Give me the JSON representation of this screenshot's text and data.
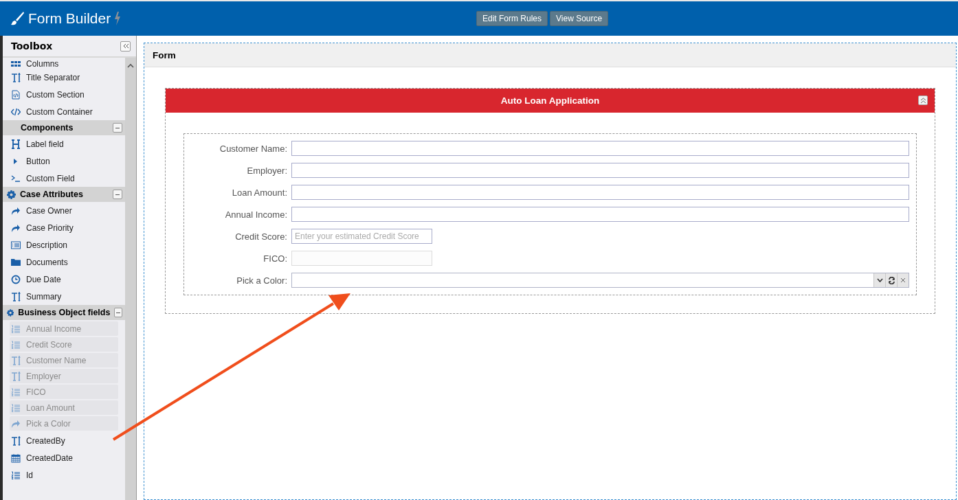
{
  "app": {
    "title": "Form Builder"
  },
  "header_buttons": [
    "Edit Form Rules",
    "View Source"
  ],
  "toolbox": {
    "title": "Toolbox",
    "top_items": [
      {
        "label": "Columns",
        "kind": "grid"
      },
      {
        "label": "Title Separator",
        "kind": "text"
      },
      {
        "label": "Custom Section",
        "kind": "codefile"
      },
      {
        "label": "Custom Container",
        "kind": "code"
      }
    ],
    "groups": [
      {
        "title": "Components",
        "kind": "plain",
        "items": [
          {
            "label": "Label field",
            "kind": "heading"
          },
          {
            "label": "Button",
            "kind": "caret"
          },
          {
            "label": "Custom Field",
            "kind": "terminal"
          }
        ]
      },
      {
        "title": "Case Attributes",
        "kind": "gear",
        "items": [
          {
            "label": "Case Owner",
            "kind": "share"
          },
          {
            "label": "Case Priority",
            "kind": "share"
          },
          {
            "label": "Description",
            "kind": "listbox"
          },
          {
            "label": "Documents",
            "kind": "folder"
          },
          {
            "label": "Due Date",
            "kind": "clock"
          },
          {
            "label": "Summary",
            "kind": "text"
          }
        ]
      },
      {
        "title": "Business Object fields",
        "kind": "gear",
        "items": [
          {
            "label": "Annual Income",
            "kind": "numlist",
            "used": true
          },
          {
            "label": "Credit Score",
            "kind": "numlist",
            "used": true
          },
          {
            "label": "Customer Name",
            "kind": "text",
            "used": true
          },
          {
            "label": "Employer",
            "kind": "text",
            "used": true
          },
          {
            "label": "FICO",
            "kind": "numlist",
            "used": true
          },
          {
            "label": "Loan Amount",
            "kind": "numlist",
            "used": true
          },
          {
            "label": "Pick a Color",
            "kind": "share",
            "used": true
          },
          {
            "label": "CreatedBy",
            "kind": "text",
            "used": false
          },
          {
            "label": "CreatedDate",
            "kind": "calendar",
            "used": false
          },
          {
            "label": "Id",
            "kind": "numlist",
            "used": false
          }
        ]
      }
    ]
  },
  "form": {
    "title": "Form",
    "section": {
      "title": "Auto Loan Application",
      "fields": [
        {
          "label": "Customer Name:",
          "kind": "text",
          "disabled": false
        },
        {
          "label": "Employer:",
          "kind": "text",
          "disabled": false
        },
        {
          "label": "Loan Amount:",
          "kind": "text",
          "disabled": false
        },
        {
          "label": "Annual Income:",
          "kind": "text",
          "disabled": false
        },
        {
          "label": "Credit Score:",
          "kind": "short",
          "placeholder": "Enter your estimated Credit Score",
          "disabled": false
        },
        {
          "label": "FICO:",
          "kind": "short",
          "disabled": true
        },
        {
          "label": "Pick a Color:",
          "kind": "combo",
          "disabled": false
        }
      ]
    }
  }
}
